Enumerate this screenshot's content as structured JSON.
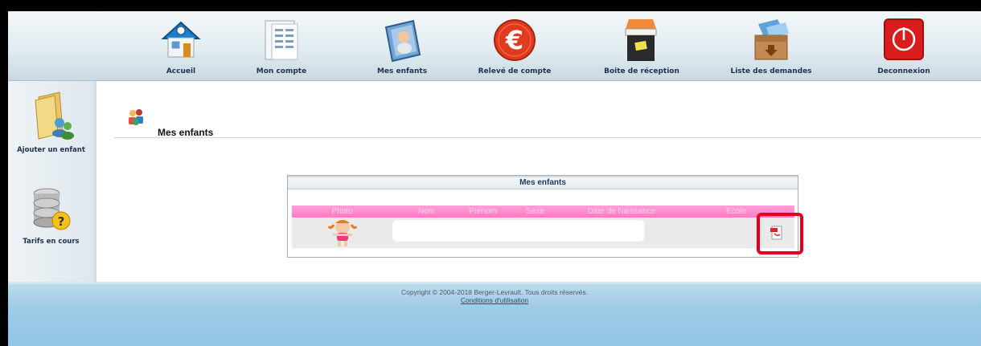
{
  "nav": {
    "items": [
      {
        "label": "Accueil",
        "icon": "house-icon"
      },
      {
        "label": "Mon compte",
        "icon": "account-document-icon"
      },
      {
        "label": "Mes enfants",
        "icon": "children-photo-icon"
      },
      {
        "label": "Relevé de compte",
        "icon": "euro-icon"
      },
      {
        "label": "Boite de réception",
        "icon": "inbox-icon"
      },
      {
        "label": "Liste des demandes",
        "icon": "requests-box-icon"
      },
      {
        "label": "Deconnexion",
        "icon": "power-icon"
      }
    ]
  },
  "sidebar": {
    "items": [
      {
        "label": "Ajouter un enfant",
        "icon": "add-child-folder-icon"
      },
      {
        "label": "Tarifs en cours",
        "icon": "tariffs-database-icon"
      }
    ]
  },
  "main": {
    "page_title": "Mes enfants",
    "panel": {
      "title": "Mes enfants",
      "columns": [
        "Photo",
        "Nom",
        "Prénom",
        "Sexe",
        "Date de Naissance",
        "Ecole"
      ],
      "row": {
        "photo_icon": "child-avatar-icon",
        "nom": "",
        "prenom": "",
        "sexe": "",
        "date_naissance": "",
        "ecole_icon": "pdf-icon"
      }
    }
  },
  "footer": {
    "copyright": "Copyright © 2004-2018 Berger-Levrault. Tous droits réservés.",
    "conditions": "Conditions d'utilisation"
  },
  "colors": {
    "accent_pink": "#ff7ac4",
    "highlight_red": "#e3001b",
    "footer_blue": "#93c5e6",
    "nav_text": "#1f3150"
  }
}
